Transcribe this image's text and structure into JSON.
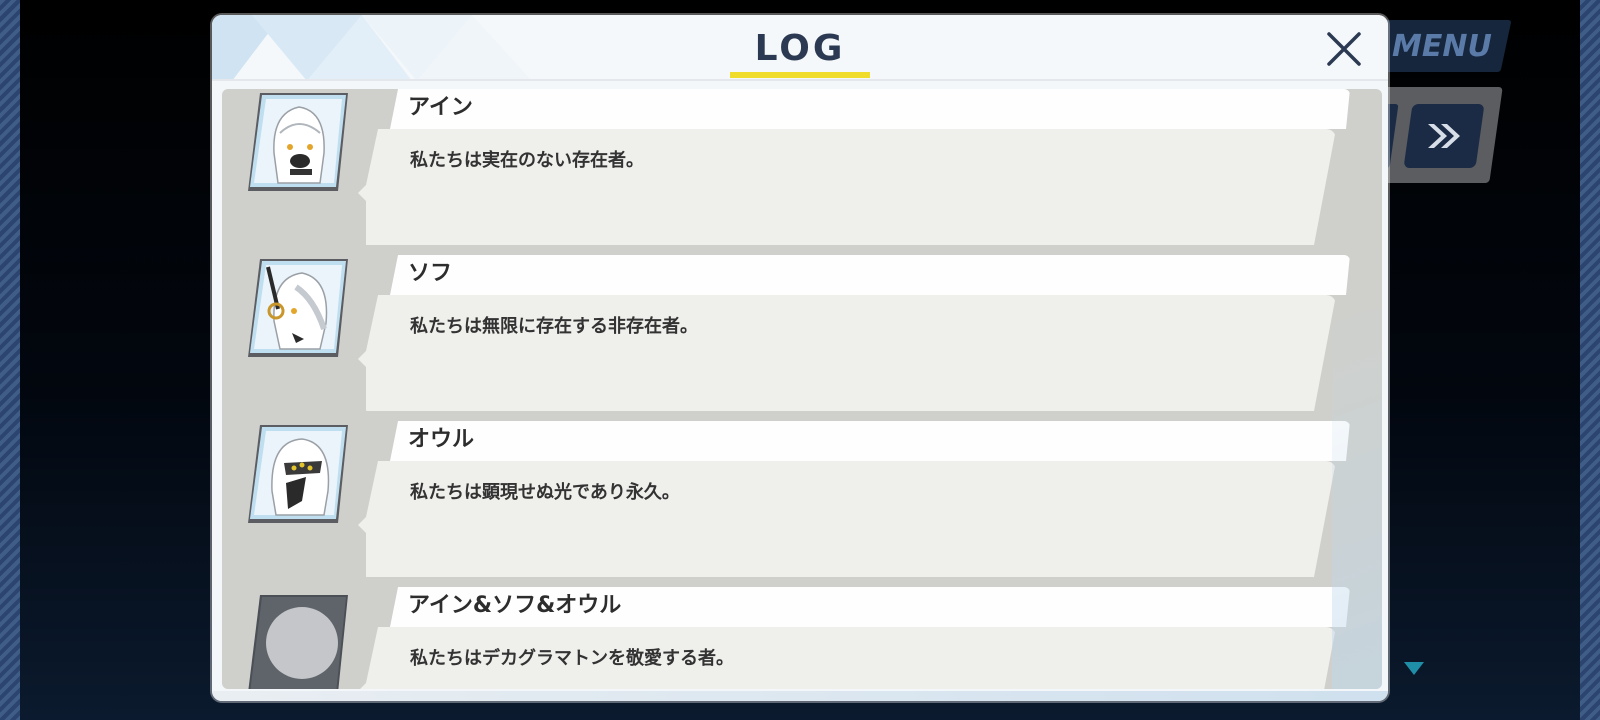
{
  "hud": {
    "menu_label": "MENU",
    "fast_forward_icon": "double-chevron-right-icon"
  },
  "log": {
    "title": "LOG",
    "close_icon": "close-icon",
    "entries": [
      {
        "speaker": "アイン",
        "text": "私たちは実在のない存在者。",
        "portrait": "ain-portrait"
      },
      {
        "speaker": "ソフ",
        "text": "私たちは無限に存在する非存在者。",
        "portrait": "soph-portrait"
      },
      {
        "speaker": "オウル",
        "text": "私たちは顕現せぬ光であり永久。",
        "portrait": "aur-portrait"
      },
      {
        "speaker": "アイン&ソフ&オウル",
        "text": "私たちはデカグラマトンを敬愛する者。",
        "portrait": "placeholder-portrait"
      }
    ]
  },
  "colors": {
    "title_underline": "#f0dc2a",
    "title_text": "#2b3a52",
    "log_background": "#cfd0cc",
    "bubble": "#efefec"
  }
}
